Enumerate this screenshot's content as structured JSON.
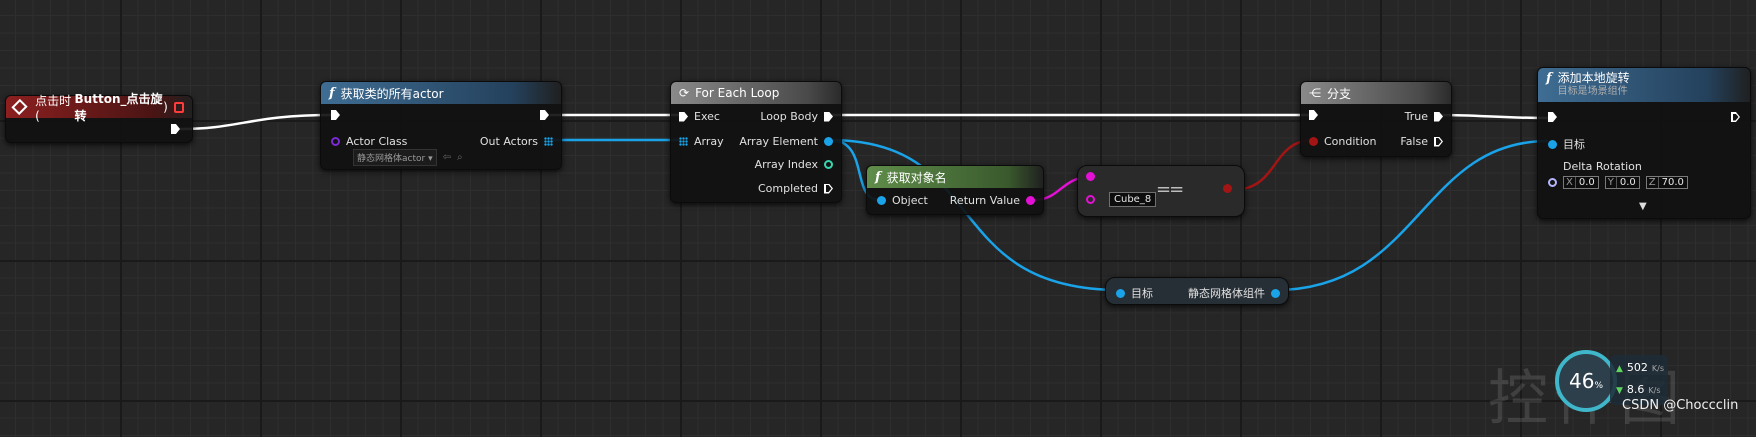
{
  "nodes": {
    "event": {
      "title_prefix": "点击时 (",
      "title_bold": "Button_点击旋转",
      "title_suffix": ")"
    },
    "get_all_actors": {
      "title": "获取类的所有actor",
      "actor_class_label": "Actor Class",
      "actor_class_value": "静态网格体actor",
      "out_actors_label": "Out Actors"
    },
    "for_each": {
      "title": "For Each Loop",
      "exec_label": "Exec",
      "loop_body_label": "Loop Body",
      "array_label": "Array",
      "array_element_label": "Array Element",
      "array_index_label": "Array Index",
      "completed_label": "Completed"
    },
    "get_object_name": {
      "title": "获取对象名",
      "object_label": "Object",
      "return_value_label": "Return Value"
    },
    "equal": {
      "symbol": "==",
      "input_value": "Cube_8"
    },
    "branch": {
      "title": "分支",
      "condition_label": "Condition",
      "true_label": "True",
      "false_label": "False"
    },
    "add_rotation": {
      "title": "添加本地旋转",
      "subtitle": "目标是场景组件",
      "target_label": "目标",
      "delta_label": "Delta Rotation",
      "x_axis": "X",
      "x": "0.0",
      "y_axis": "Y",
      "y": "0.0",
      "z_axis": "Z",
      "z": "70.0"
    },
    "get_component": {
      "target_label": "目标",
      "output_label": "静态网格体组件"
    }
  },
  "overlay": {
    "watermark": "控件图",
    "gauge_value": "46",
    "gauge_unit": "%",
    "upload": "502",
    "upload_unit": "K/s",
    "download": "8.6",
    "download_unit": "K/s",
    "credit": "CSDN @Choccclin"
  },
  "colors": {
    "exec": "#ffffff",
    "object_wire": "#1aa3e8",
    "string_wire": "#e510d6",
    "bool_wire": "#a31515"
  }
}
